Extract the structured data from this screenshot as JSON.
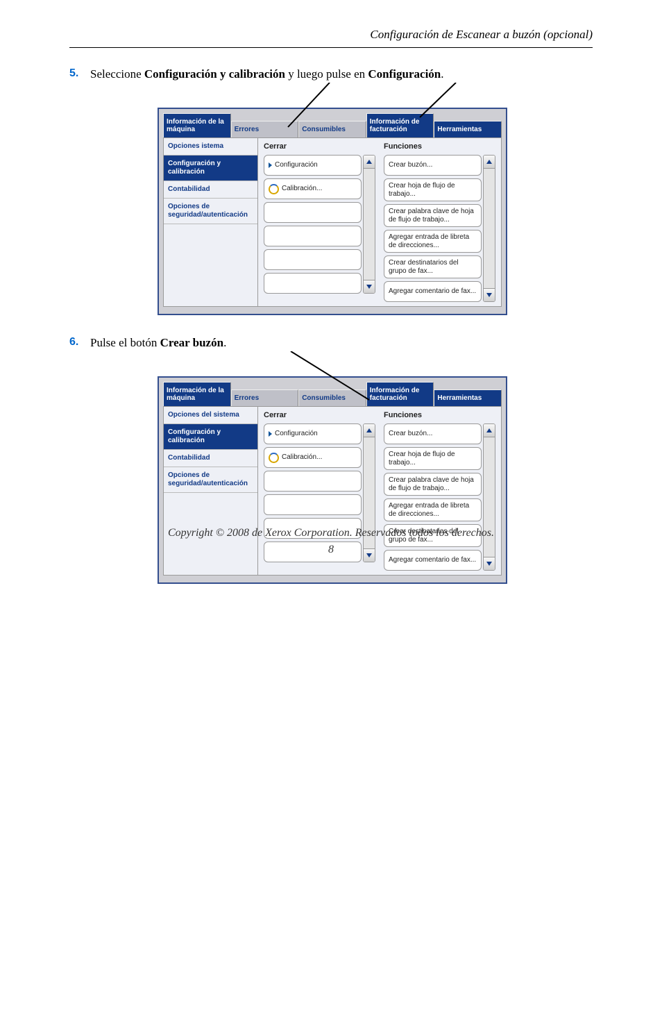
{
  "header": {
    "title": "Configuración de Escanear a buzón (opcional)"
  },
  "steps": [
    {
      "num": "5.",
      "pre": "Seleccione ",
      "b1": "Configuración y calibración",
      "mid": " y luego pulse en ",
      "b2": "Configuración",
      "suf": "."
    },
    {
      "num": "6.",
      "pre": "Pulse el botón ",
      "b1": "Crear buzón",
      "mid": "",
      "b2": "",
      "suf": "."
    }
  ],
  "tabs": {
    "machine_info": "Información de la máquina",
    "errors": "Errores",
    "consumables": "Consumibles",
    "billing_info": "Información de facturación",
    "tools": "Herramientas"
  },
  "sidebar": {
    "system_options_split": "Opciones    istema",
    "system_options": "Opciones del sistema",
    "config_calib": "Configuración y calibración",
    "accounting": "Contabilidad",
    "security": "Opciones de seguridad/autenticación"
  },
  "col_headers": {
    "close": "Cerrar",
    "functions": "Funciones"
  },
  "left_items": {
    "configuration": "Configuración",
    "calibration": "Calibración..."
  },
  "right_items": {
    "create_mailbox": "Crear buzón...",
    "create_workflow_sheet": "Crear hoja de flujo de trabajo...",
    "create_workflow_password": "Crear palabra clave de hoja de flujo de trabajo...",
    "add_address_book_entry": "Agregar entrada de libreta de direcciones...",
    "create_fax_group_recipients": "Crear destinatarios del grupo de fax...",
    "add_fax_comment": "Agregar comentario de fax..."
  },
  "footer": {
    "copyright": "Copyright © 2008 de Xerox Corporation. Reservados todos los derechos.",
    "page": "8"
  }
}
